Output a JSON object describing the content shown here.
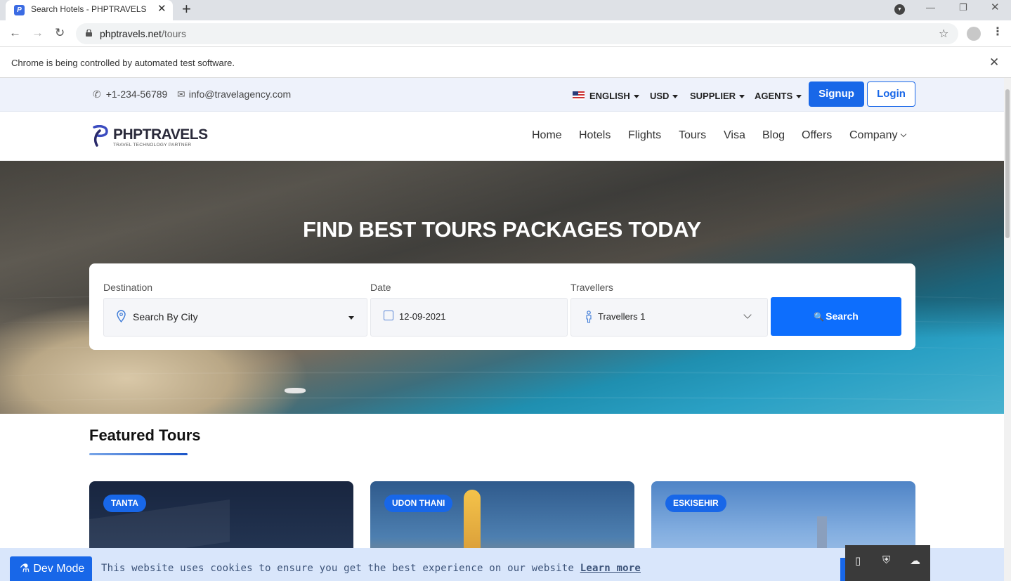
{
  "browser": {
    "tab_title": "Search Hotels - PHPTRAVELS",
    "url_host": "phptravels.net",
    "url_path": "/tours",
    "infobar_text": "Chrome is being controlled by automated test software."
  },
  "topbar": {
    "phone": "+1-234-56789",
    "email": "info@travelagency.com",
    "language": "ENGLISH",
    "currency": "USD",
    "supplier": "SUPPLIER",
    "agents": "AGENTS",
    "signup": "Signup",
    "login": "Login"
  },
  "logo": {
    "name": "PHPTRAVELS",
    "tagline": "TRAVEL TECHNOLOGY PARTNER"
  },
  "nav": {
    "items": [
      "Home",
      "Hotels",
      "Flights",
      "Tours",
      "Visa",
      "Blog",
      "Offers",
      "Company"
    ]
  },
  "hero": {
    "title": "FIND BEST TOURS PACKAGES TODAY"
  },
  "search": {
    "destination_label": "Destination",
    "destination_value": "Search By City",
    "date_label": "Date",
    "date_value": "12-09-2021",
    "travellers_label": "Travellers",
    "travellers_value": "Travellers 1",
    "button": "Search"
  },
  "featured": {
    "title": "Featured Tours",
    "cards": [
      {
        "city": "TANTA"
      },
      {
        "city": "UDON THANI"
      },
      {
        "city": "ESKISEHIR"
      }
    ]
  },
  "cookie": {
    "text": "This website uses cookies to ensure you get the best experience on our website",
    "link": "Learn more"
  },
  "devmode": {
    "label": "Dev Mode"
  },
  "colors": {
    "primary": "#1867e8",
    "search_button": "#0d6efd",
    "topbar_bg": "#eef2fb",
    "cookie_bg": "#d9e6fb"
  }
}
